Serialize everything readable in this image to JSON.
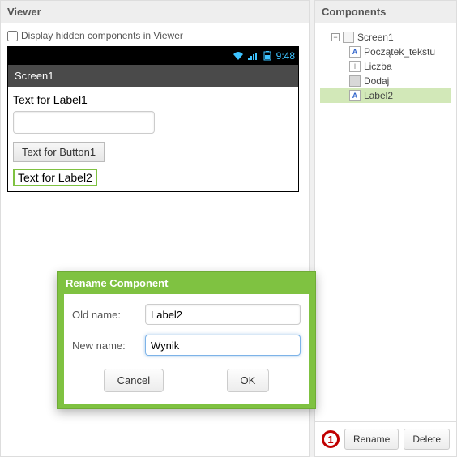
{
  "viewer": {
    "title": "Viewer",
    "checkbox_label": "Display hidden components in Viewer",
    "status_time": "9:48",
    "screen_title": "Screen1",
    "label1_text": "Text for Label1",
    "button1_text": "Text for Button1",
    "label2_text": "Text for Label2"
  },
  "components": {
    "title": "Components",
    "items": [
      {
        "name": "Screen1",
        "icon": "screen"
      },
      {
        "name": "Początek_tekstu",
        "icon": "label"
      },
      {
        "name": "Liczba",
        "icon": "text"
      },
      {
        "name": "Dodaj",
        "icon": "button"
      },
      {
        "name": "Label2",
        "icon": "label",
        "selected": true
      }
    ],
    "rename_label": "Rename",
    "delete_label": "Delete",
    "step_marker": "1"
  },
  "dialog": {
    "title": "Rename Component",
    "old_name_label": "Old name:",
    "old_name_value": "Label2",
    "new_name_label": "New name:",
    "new_name_value": "Wynik",
    "cancel_label": "Cancel",
    "ok_label": "OK"
  }
}
